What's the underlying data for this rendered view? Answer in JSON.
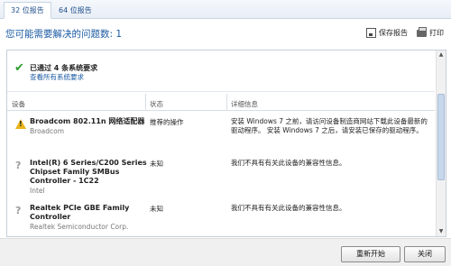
{
  "tabs": [
    {
      "label": "32 位报告",
      "active": true
    },
    {
      "label": "64 位报告",
      "active": false
    }
  ],
  "header": {
    "title": "您可能需要解决的问题数: 1"
  },
  "toolbar": {
    "save_label": "保存报告",
    "print_label": "打印"
  },
  "summary": {
    "title": "已通过 4 条系统要求",
    "link": "查看所有系统要求"
  },
  "columns": {
    "device": "设备",
    "status": "状态",
    "detail": "详细信息"
  },
  "rows": [
    {
      "icon": "warning-icon",
      "device": "Broadcom 802.11n 网络适配器",
      "vendor": "Broadcom",
      "status": "推荐的操作",
      "detail": "安装 Windows 7 之前，请访问设备制造商网站下载此设备最新的驱动程序。 安装 Windows 7 之后，请安装已保存的驱动程序。"
    },
    {
      "icon": "question-icon",
      "device": "Intel(R) 6 Series/C200 Series Chipset Family SMBus Controller - 1C22",
      "vendor": "Intel",
      "status": "未知",
      "detail": "我们不具有有关此设备的兼容性信息。"
    },
    {
      "icon": "question-icon",
      "device": "Realtek PCIe GBE Family Controller",
      "vendor": "Realtek Semiconductor Corp.",
      "status": "未知",
      "detail": "我们不具有有关此设备的兼容性信息。"
    }
  ],
  "footer": {
    "restart_label": "重新开始",
    "close_label": "关闭"
  },
  "colors": {
    "accent": "#1b5aa3",
    "success": "#2e9d2e",
    "warning": "#e9b51c"
  }
}
